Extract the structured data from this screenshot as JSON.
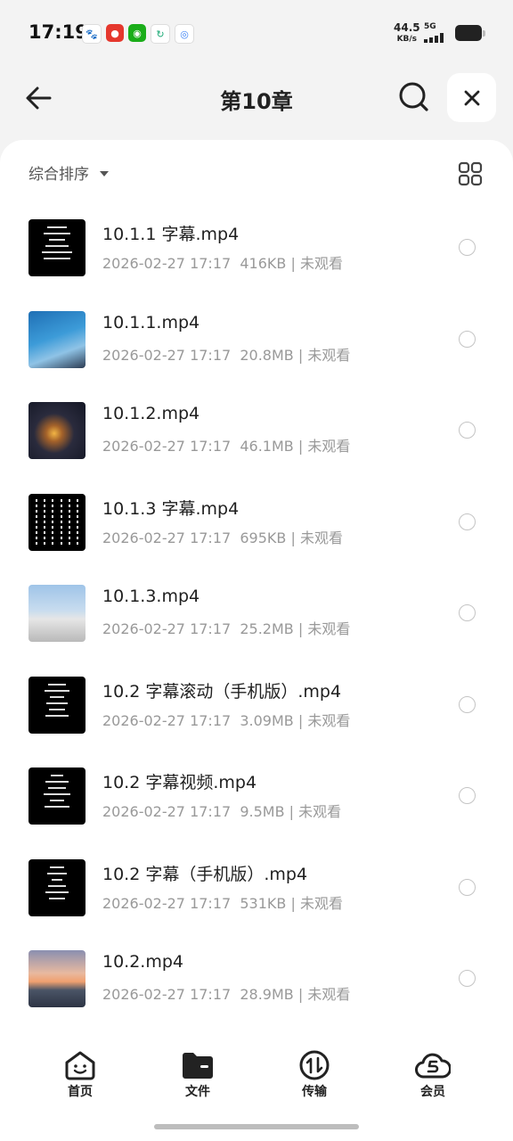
{
  "status_bar": {
    "time": "17:19",
    "net_speed_value": "44.5",
    "net_speed_unit": "KB/s",
    "network": "5G",
    "apps": [
      {
        "name": "baidu-paw-icon",
        "color": "#2e6be6"
      },
      {
        "name": "red-app-icon",
        "color": "#e5372d"
      },
      {
        "name": "wechat-icon",
        "color": "#1aad19"
      },
      {
        "name": "green-swirl-icon",
        "color": "#19a974"
      },
      {
        "name": "baidu-netdisk-icon",
        "color": "#3b82f6"
      }
    ]
  },
  "header": {
    "title": "第10章"
  },
  "sort": {
    "label": "综合排序"
  },
  "files": [
    {
      "name": "10.1.1  字幕.mp4",
      "date": "2026-02-27 17:17",
      "size": "416KB",
      "status": "未观看",
      "thumb": "subtitle-lines"
    },
    {
      "name": "10.1.1.mp4",
      "date": "2026-02-27 17:17",
      "size": "20.8MB",
      "status": "未观看",
      "thumb": "sky"
    },
    {
      "name": "10.1.2.mp4",
      "date": "2026-02-27 17:17",
      "size": "46.1MB",
      "status": "未观看",
      "thumb": "city-night"
    },
    {
      "name": "10.1.3  字幕.mp4",
      "date": "2026-02-27 17:17",
      "size": "695KB",
      "status": "未观看",
      "thumb": "subtitle-columns"
    },
    {
      "name": "10.1.3.mp4",
      "date": "2026-02-27 17:17",
      "size": "25.2MB",
      "status": "未观看",
      "thumb": "bridge"
    },
    {
      "name": "10.2  字幕滚动（手机版）.mp4",
      "date": "2026-02-27 17:17",
      "size": "3.09MB",
      "status": "未观看",
      "thumb": "subtitle-lines"
    },
    {
      "name": "10.2  字幕视频.mp4",
      "date": "2026-02-27 17:17",
      "size": "9.5MB",
      "status": "未观看",
      "thumb": "subtitle-lines"
    },
    {
      "name": "10.2  字幕（手机版）.mp4",
      "date": "2026-02-27 17:17",
      "size": "531KB",
      "status": "未观看",
      "thumb": "subtitle-lines"
    },
    {
      "name": "10.2.mp4",
      "date": "2026-02-27 17:17",
      "size": "28.9MB",
      "status": "未观看",
      "thumb": "sunset-lake"
    }
  ],
  "nav": [
    {
      "label": "首页",
      "icon": "home-face-icon"
    },
    {
      "label": "文件",
      "icon": "folder-icon"
    },
    {
      "label": "传输",
      "icon": "transfer-icon"
    },
    {
      "label": "会员",
      "icon": "vip-cloud-icon"
    }
  ]
}
